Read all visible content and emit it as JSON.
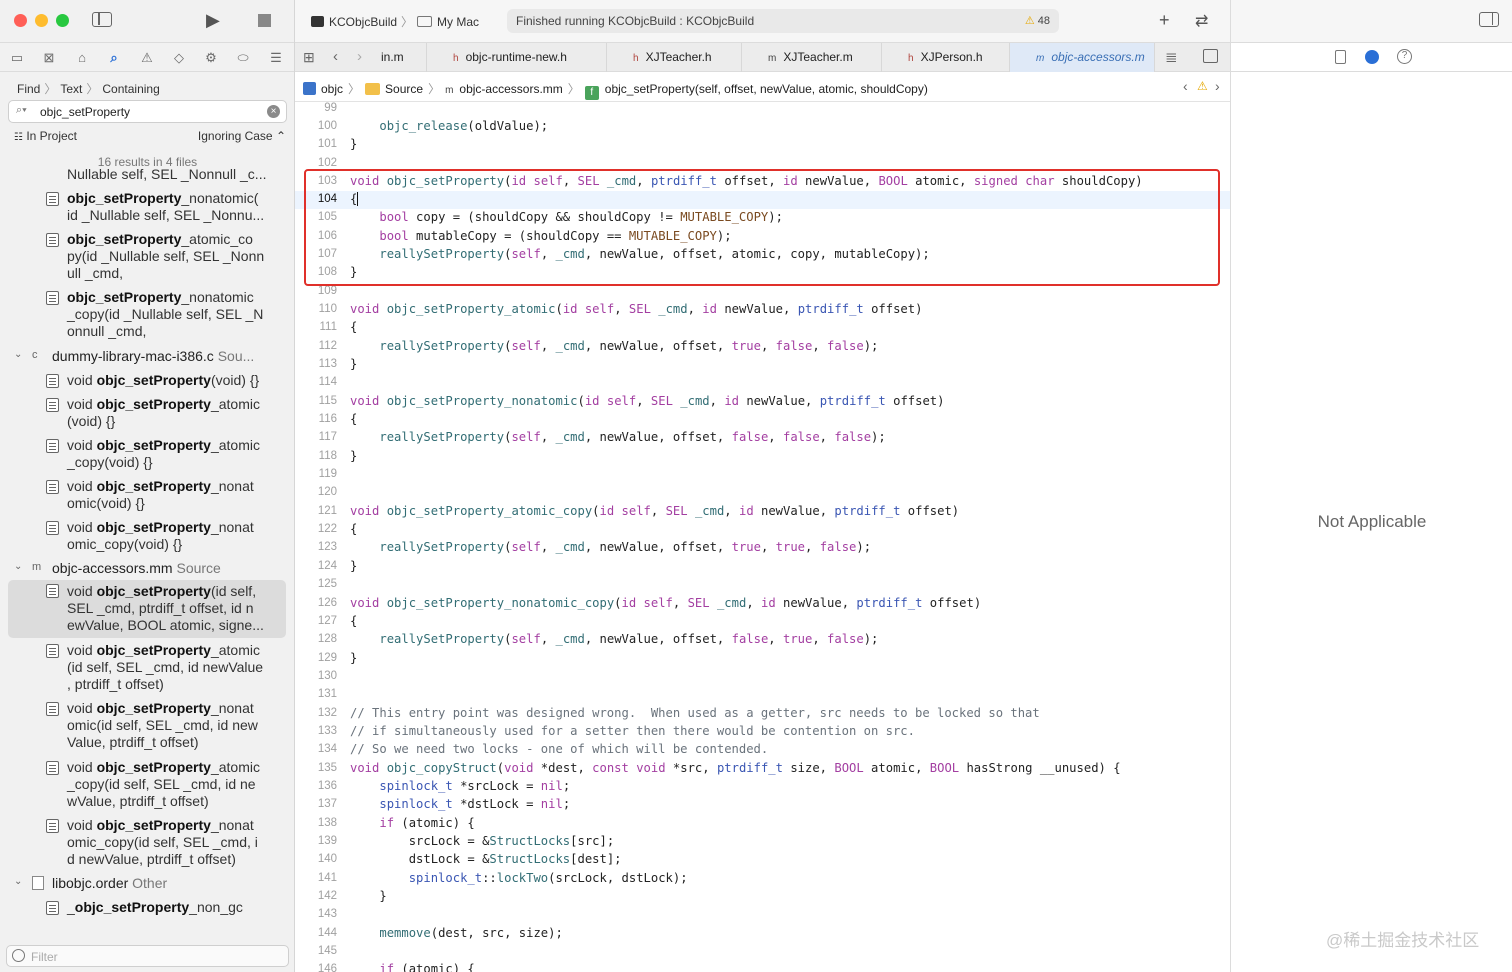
{
  "window": {
    "scheme": "KCObjcBuild",
    "destination": "My Mac",
    "status": "Finished running KCObjcBuild : KCObjcBuild",
    "warnings": "48"
  },
  "find": {
    "mode": "Find",
    "kind": "Text",
    "match": "Containing",
    "query": "objc_setProperty",
    "scope": "In Project",
    "case_mode": "Ignoring Case",
    "summary": "16 results in 4 files",
    "filter_placeholder": "Filter"
  },
  "results": {
    "top_clipped": "Nullable self, SEL _Nonnull _c...",
    "r1": {
      "bold": "objc_setProperty",
      "rest": "_nonatomic(\nid _Nullable self, SEL _Nonnu..."
    },
    "r2": {
      "bold": "objc_setProperty",
      "rest": "_atomic_co\npy(id _Nullable self, SEL _Nonn\null _cmd,"
    },
    "r3": {
      "bold": "objc_setProperty",
      "rest": "_nonatomic\n_copy(id _Nullable self, SEL _N\nonnull _cmd,"
    },
    "g1": {
      "name": "dummy-library-mac-i386.c",
      "kind": "Sou...",
      "icon": "c"
    },
    "r4": {
      "pre": "void ",
      "bold": "objc_setProperty",
      "rest": "(void) {}"
    },
    "r5": {
      "pre": "void ",
      "bold": "objc_setProperty",
      "rest": "_atomic\n(void) {}"
    },
    "r6": {
      "pre": "void ",
      "bold": "objc_setProperty",
      "rest": "_atomic\n_copy(void) {}"
    },
    "r7": {
      "pre": "void ",
      "bold": "objc_setProperty",
      "rest": "_nonat\nomic(void) {}"
    },
    "r8": {
      "pre": "void ",
      "bold": "objc_setProperty",
      "rest": "_nonat\nomic_copy(void) {}"
    },
    "g2": {
      "name": "objc-accessors.mm",
      "kind": "Source",
      "icon": "m"
    },
    "r9": {
      "pre": "void ",
      "bold": "objc_setProperty",
      "rest": "(id self,\nSEL _cmd, ptrdiff_t offset, id n\newValue, BOOL atomic, signe..."
    },
    "r10": {
      "pre": "void ",
      "bold": "objc_setProperty",
      "rest": "_atomic\n(id self, SEL _cmd, id newValue\n, ptrdiff_t offset)"
    },
    "r11": {
      "pre": "void ",
      "bold": "objc_setProperty",
      "rest": "_nonat\nomic(id self, SEL _cmd, id new\nValue, ptrdiff_t offset)"
    },
    "r12": {
      "pre": "void ",
      "bold": "objc_setProperty",
      "rest": "_atomic\n_copy(id self, SEL _cmd, id ne\nwValue, ptrdiff_t offset)"
    },
    "r13": {
      "pre": "void ",
      "bold": "objc_setProperty",
      "rest": "_nonat\nomic_copy(id self, SEL _cmd, i\nd newValue, ptrdiff_t offset)"
    },
    "g3": {
      "name": "libobjc.order",
      "kind": "Other"
    },
    "r14": {
      "pre": "_",
      "bold": "objc_setProperty",
      "rest": "_non_gc"
    }
  },
  "tabs": [
    {
      "label": "in.m",
      "type": ""
    },
    {
      "label": "objc-runtime-new.h",
      "type": "h"
    },
    {
      "label": "XJTeacher.h",
      "type": "h"
    },
    {
      "label": "XJTeacher.m",
      "type": "m"
    },
    {
      "label": "XJPerson.h",
      "type": "h"
    },
    {
      "label": "objc-accessors.m",
      "type": "m"
    }
  ],
  "jumpbar": {
    "project": "objc",
    "folder": "Source",
    "file": "objc-accessors.mm",
    "symbol": "objc_setProperty(self, offset, newValue, atomic, shouldCopy)"
  },
  "code": {
    "l99": "99",
    "l100": "100",
    "l101": "101",
    "l102": "102",
    "l103": "103",
    "l104": "104",
    "l105": "105",
    "l106": "106",
    "l107": "107",
    "l108": "108",
    "l109": "109",
    "l110": "110",
    "l111": "111",
    "l112": "112",
    "l113": "113",
    "l114": "114",
    "l115": "115",
    "l116": "116",
    "l117": "117",
    "l118": "118",
    "l119": "119",
    "l120": "120",
    "l121": "121",
    "l122": "122",
    "l123": "123",
    "l124": "124",
    "l125": "125",
    "l126": "126",
    "l127": "127",
    "l128": "128",
    "l129": "129",
    "l130": "130",
    "l131": "131",
    "l132": "132",
    "l133": "133",
    "l134": "134",
    "l135": "135",
    "l136": "136",
    "l137": "137",
    "l138": "138",
    "l139": "139",
    "l140": "140",
    "l141": "141",
    "l142": "142",
    "l143": "143",
    "l144": "144",
    "l145": "145",
    "l146": "146",
    "c132": "// This entry point was designed wrong.  When used as a getter, src needs to be locked so that",
    "c133": "// if simultaneously used for a setter then there would be contention on src.",
    "c134": "// So we need two locks - one of which will be contended."
  },
  "inspector": {
    "empty_text": "Not Applicable"
  },
  "watermark": "@稀土掘金技术社区",
  "colors": {
    "highlight_box": "#e0302a",
    "keyword": "#a33ea1",
    "type": "#3a56b3",
    "function": "#326d74",
    "macro": "#7a4a20"
  }
}
